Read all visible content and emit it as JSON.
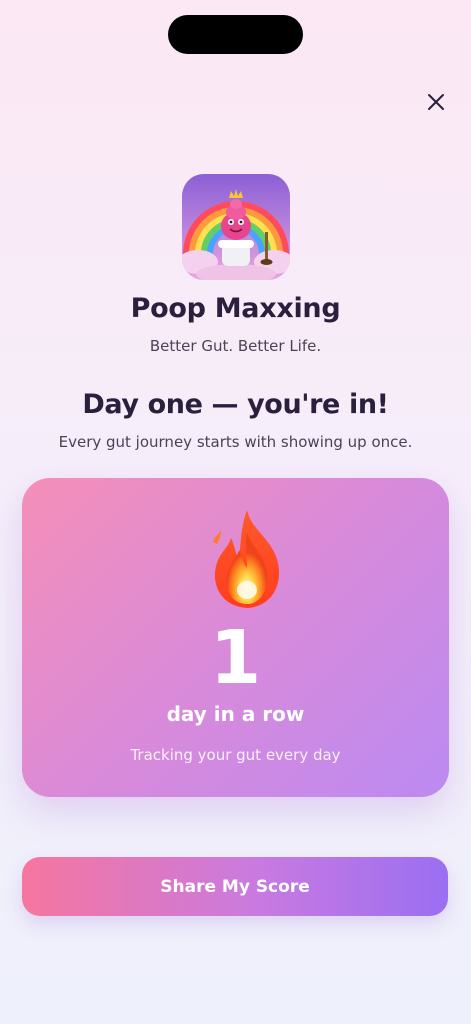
{
  "app": {
    "name": "Poop Maxxing",
    "tagline": "Better Gut. Better Life."
  },
  "header": {
    "close_icon": "close-icon"
  },
  "hero": {
    "headline": "Day one — you're in!",
    "subline": "Every gut journey starts with showing up once."
  },
  "streak": {
    "icon": "fire-icon",
    "count": "1",
    "unit_label": "day in a row",
    "caption": "Tracking your gut every day"
  },
  "actions": {
    "share_label": "Share My Score"
  },
  "colors": {
    "card_start": "#f58fb8",
    "card_end": "#bb8af2",
    "button_start": "#f6769e",
    "button_end": "#9a6ff2",
    "text_dark": "#2a1f3d"
  }
}
